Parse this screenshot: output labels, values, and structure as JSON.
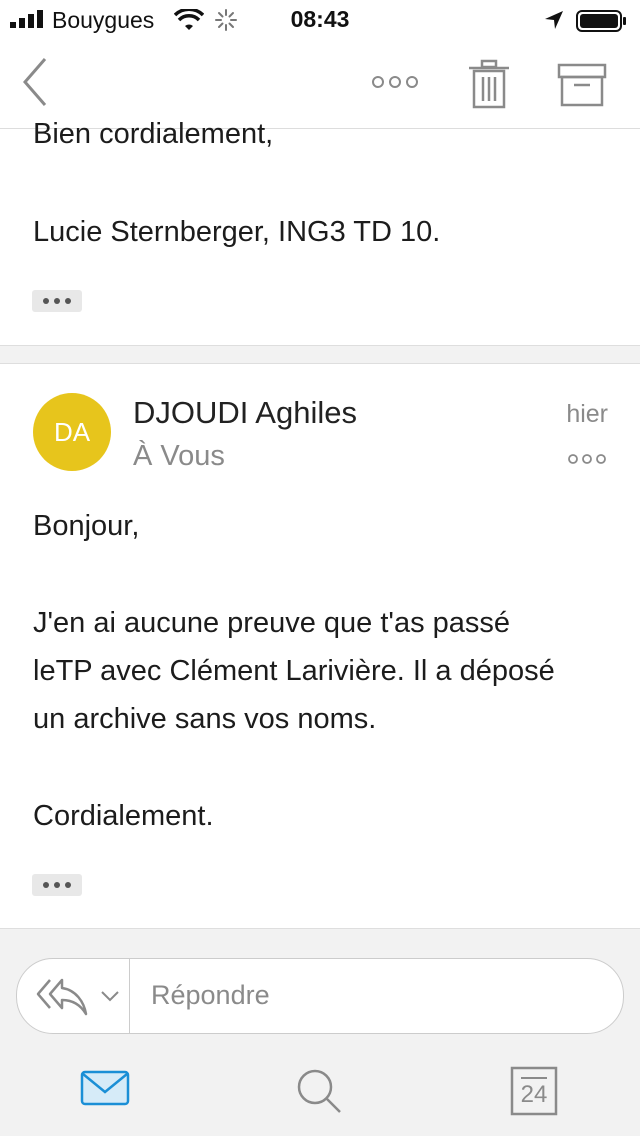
{
  "status_bar": {
    "carrier": "Bouygues",
    "time": "08:43"
  },
  "toolbar": {
    "back_icon": "chevron-left-icon",
    "more_icon": "more-horizontal-icon",
    "delete_icon": "trash-icon",
    "archive_icon": "archive-icon"
  },
  "previous_message": {
    "closing": "Bien cordialement,",
    "signature": "Lucie Sternberger, ING3 TD 10."
  },
  "message": {
    "avatar_initials": "DA",
    "avatar_color": "#e7c51c",
    "sender": "DJOUDI Aghiles",
    "recipient": "À Vous",
    "date": "hier",
    "greeting": "Bonjour,",
    "body_line1": "J'en ai aucune preuve que t'as passé",
    "body_line2": "leTP avec Clément Larivière. Il a déposé",
    "body_line3": "un archive sans vos noms.",
    "closing": "Cordialement."
  },
  "reply_bar": {
    "placeholder": "Répondre"
  },
  "bottom_nav": {
    "mail_icon": "mail-icon",
    "search_icon": "search-icon",
    "calendar_day": "24",
    "accent": "#1b8fd6"
  }
}
